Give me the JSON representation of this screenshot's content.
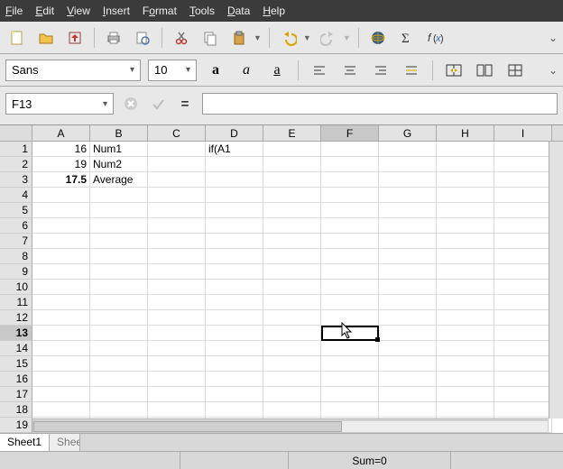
{
  "menu": {
    "file": "File",
    "edit": "Edit",
    "view": "View",
    "insert": "Insert",
    "format": "Format",
    "tools": "Tools",
    "data": "Data",
    "help": "Help"
  },
  "font": {
    "name": "Sans",
    "size": "10"
  },
  "formula_bar": {
    "cell_ref": "F13",
    "formula": ""
  },
  "columns": [
    "A",
    "B",
    "C",
    "D",
    "E",
    "F",
    "G",
    "H",
    "I"
  ],
  "active_col_index": 5,
  "row_count": 19,
  "active_row": 13,
  "cells": {
    "A1": "16",
    "B1": "Num1",
    "D1": "if(A1",
    "A2": "19",
    "B2": "Num2",
    "A3": "17.5",
    "B3": "Average"
  },
  "tabs": {
    "active": "Sheet1",
    "partial": "Shee"
  },
  "status": {
    "sum": "Sum=0"
  }
}
